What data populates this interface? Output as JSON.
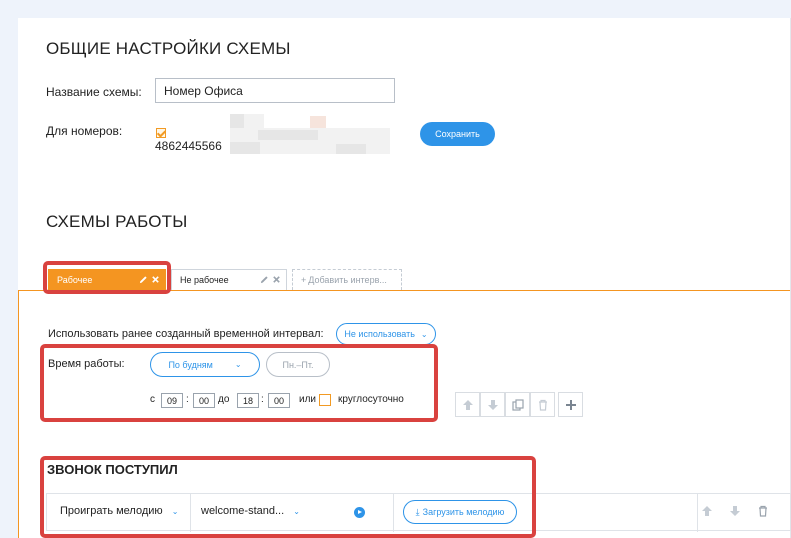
{
  "general": {
    "title": "ОБЩИЕ НАСТРОЙКИ СХЕМЫ",
    "scheme_name_label": "Название схемы:",
    "scheme_name_value": "Номер Офиса",
    "numbers_label": "Для номеров:",
    "phone_number": "4862445566",
    "save_label": "Сохранить"
  },
  "work": {
    "title": "СХЕМЫ РАБОТЫ",
    "tabs": [
      {
        "label": "Рабочее",
        "active": true
      },
      {
        "label": "Не рабочее",
        "active": false
      }
    ],
    "add_tab_label": "Добавить интерв...",
    "use_interval_label": "Использовать ранее созданный временной интервал:",
    "use_interval_value": "Не использовать",
    "work_time_label": "Время работы:",
    "weekday_select": "По будням",
    "days_range": "Пн.–Пт.",
    "from_label": "с",
    "from_hour": "09",
    "from_min": "00",
    "to_label": "до",
    "to_hour": "18",
    "to_min": "00",
    "or_label": "или",
    "round_clock_label": "круглосуточно"
  },
  "call": {
    "title": "ЗВОНОК ПОСТУПИЛ",
    "action": "Проиграть мелодию",
    "melody": "welcome-stand...",
    "upload_label": "Загрузить мелодию"
  },
  "colors": {
    "accent_orange": "#f49521",
    "accent_blue": "#2e94e8",
    "highlight_red": "#d9423f"
  }
}
